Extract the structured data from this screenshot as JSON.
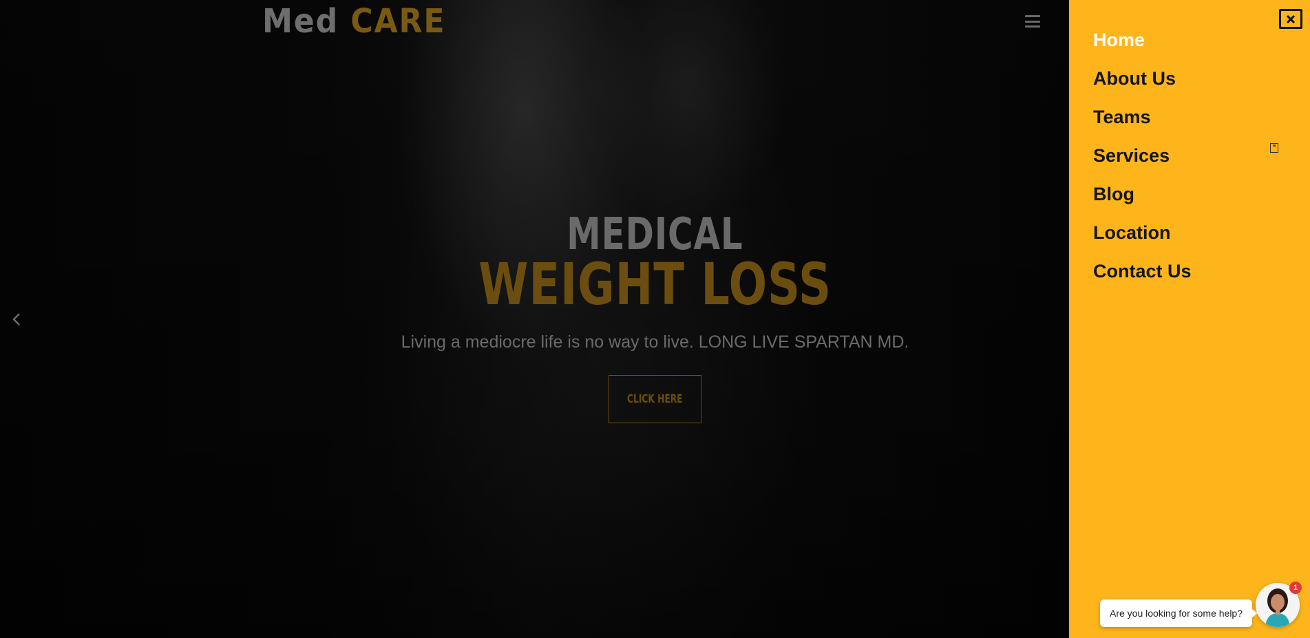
{
  "header": {
    "logo_part1": "Med",
    "logo_part2": "CARE",
    "menu_icon": "hamburger-icon"
  },
  "hero": {
    "title_line1": "MEDICAL",
    "title_line2": "WEIGHT LOSS",
    "subtitle": "Living a mediocre life is no way to live. LONG LIVE SPARTAN MD.",
    "cta_label": "CLICK HERE",
    "prev_icon": "chevron-left-icon"
  },
  "side_menu": {
    "close_icon": "close-icon",
    "items": [
      {
        "label": "Home",
        "active": true
      },
      {
        "label": "About Us"
      },
      {
        "label": "Teams"
      },
      {
        "label": "Services",
        "has_submenu": true
      },
      {
        "label": "Blog"
      },
      {
        "label": "Location"
      },
      {
        "label": "Contact Us"
      }
    ],
    "submenu_toggle_icon": "submenu-toggle-icon"
  },
  "chat": {
    "prompt": "Are you looking for some help?",
    "badge_count": "1",
    "avatar_icon": "support-agent-avatar"
  },
  "colors": {
    "accent": "#fdb51b",
    "hero_gold": "#6b4e0f",
    "hero_gray": "#6a6a6a"
  }
}
